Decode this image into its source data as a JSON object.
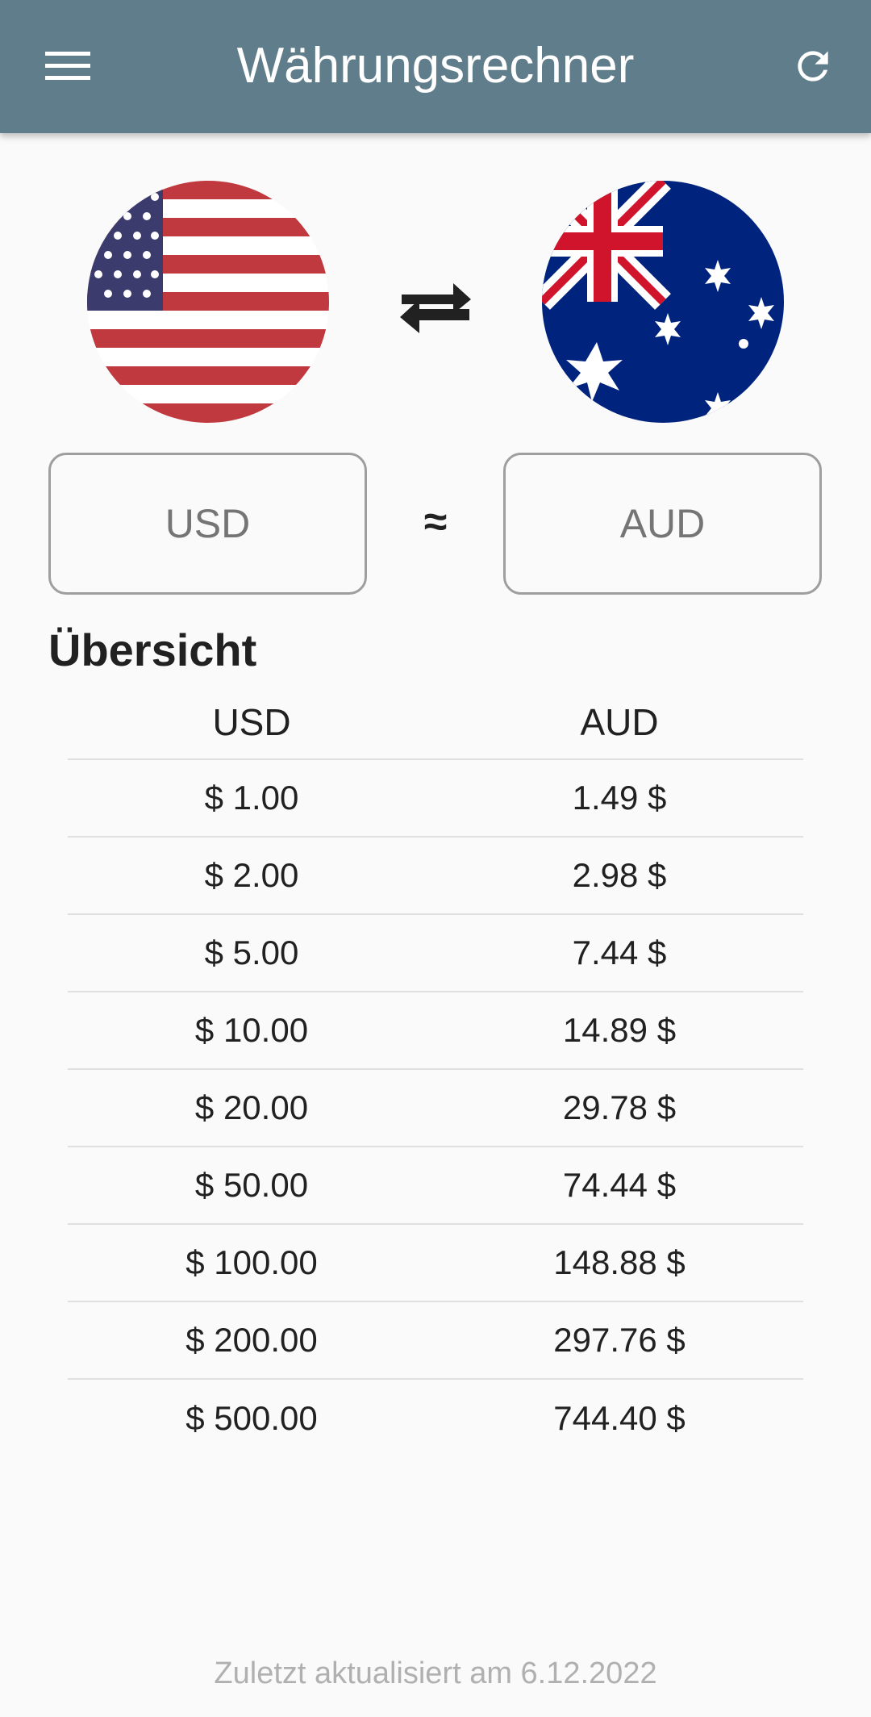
{
  "appbar": {
    "title": "Währungsrechner",
    "menu_icon": "hamburger-menu-icon",
    "refresh_icon": "refresh-icon",
    "color": "#607d8b"
  },
  "converter": {
    "from_currency": "USD",
    "to_currency": "AUD",
    "approx_symbol": "≈",
    "from_flag": "usa-flag-icon",
    "to_flag": "australia-flag-icon",
    "swap_icon": "swap-arrows-icon"
  },
  "overview": {
    "title": "Übersicht",
    "headers": [
      "USD",
      "AUD"
    ],
    "rows": [
      [
        "$ 1.00",
        "1.49 $"
      ],
      [
        "$ 2.00",
        "2.98 $"
      ],
      [
        "$ 5.00",
        "7.44 $"
      ],
      [
        "$ 10.00",
        "14.89 $"
      ],
      [
        "$ 20.00",
        "29.78 $"
      ],
      [
        "$ 50.00",
        "74.44 $"
      ],
      [
        "$ 100.00",
        "148.88 $"
      ],
      [
        "$ 200.00",
        "297.76 $"
      ],
      [
        "$ 500.00",
        "744.40 $"
      ]
    ]
  },
  "footer": {
    "last_updated": "Zuletzt aktualisiert am 6.12.2022"
  }
}
